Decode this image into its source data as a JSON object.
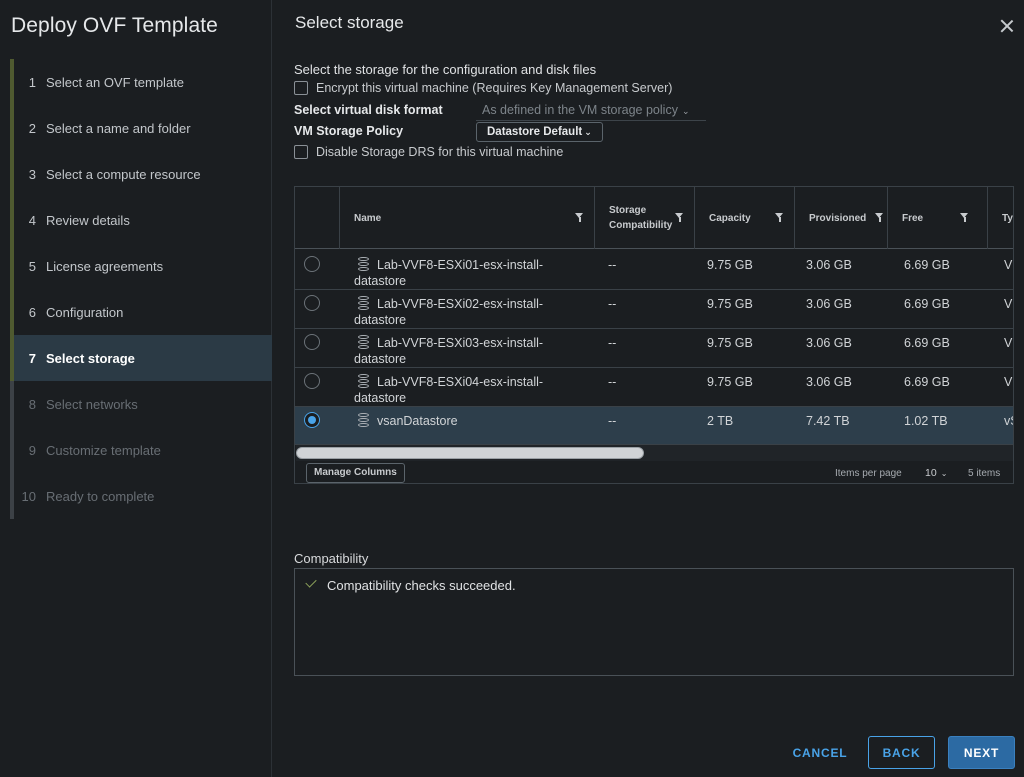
{
  "wizard": {
    "title": "Deploy OVF Template",
    "steps": [
      {
        "num": "1",
        "label": "Select an OVF template"
      },
      {
        "num": "2",
        "label": "Select a name and folder"
      },
      {
        "num": "3",
        "label": "Select a compute resource"
      },
      {
        "num": "4",
        "label": "Review details"
      },
      {
        "num": "5",
        "label": "License agreements"
      },
      {
        "num": "6",
        "label": "Configuration"
      },
      {
        "num": "7",
        "label": "Select storage"
      },
      {
        "num": "8",
        "label": "Select networks"
      },
      {
        "num": "9",
        "label": "Customize template"
      },
      {
        "num": "10",
        "label": "Ready to complete"
      }
    ],
    "current_step": 7
  },
  "page": {
    "title": "Select storage",
    "intro": "Select the storage for the configuration and disk files",
    "encrypt_label": "Encrypt this virtual machine (Requires Key Management Server)",
    "disk_format_label": "Select virtual disk format",
    "disk_format_value": "As defined in the VM storage policy",
    "policy_label": "VM Storage Policy",
    "policy_value": "Datastore Default",
    "disable_drs_label": "Disable Storage DRS for this virtual machine"
  },
  "grid": {
    "columns": {
      "name": "Name",
      "compat_line1": "Storage",
      "compat_line2": "Compatibility",
      "capacity": "Capacity",
      "provisioned": "Provisioned",
      "free": "Free",
      "type": "Ty"
    },
    "rows": [
      {
        "name": "Lab-VVF8-ESXi01-esx-install-datastore",
        "compat": "--",
        "capacity": "9.75 GB",
        "provisioned": "3.06 GB",
        "free": "6.69 GB",
        "type": "V",
        "selected": false
      },
      {
        "name": "Lab-VVF8-ESXi02-esx-install-datastore",
        "compat": "--",
        "capacity": "9.75 GB",
        "provisioned": "3.06 GB",
        "free": "6.69 GB",
        "type": "V",
        "selected": false
      },
      {
        "name": "Lab-VVF8-ESXi03-esx-install-datastore",
        "compat": "--",
        "capacity": "9.75 GB",
        "provisioned": "3.06 GB",
        "free": "6.69 GB",
        "type": "V",
        "selected": false
      },
      {
        "name": "Lab-VVF8-ESXi04-esx-install-datastore",
        "compat": "--",
        "capacity": "9.75 GB",
        "provisioned": "3.06 GB",
        "free": "6.69 GB",
        "type": "V",
        "selected": false
      },
      {
        "name": "vsanDatastore",
        "compat": "--",
        "capacity": "2 TB",
        "provisioned": "7.42 TB",
        "free": "1.02 TB",
        "type": "vS",
        "selected": true
      }
    ],
    "manage_columns": "Manage Columns",
    "items_per_page_label": "Items per page",
    "items_per_page": "10",
    "total_items": "5 items"
  },
  "compatibility": {
    "label": "Compatibility",
    "message": "Compatibility checks succeeded."
  },
  "footer": {
    "cancel": "CANCEL",
    "back": "BACK",
    "next": "NEXT"
  },
  "colors": {
    "accent": "#49a3e8",
    "primary_button": "#2c6aa3",
    "success": "#8ea35a",
    "selected_row": "#2d3e4b"
  }
}
